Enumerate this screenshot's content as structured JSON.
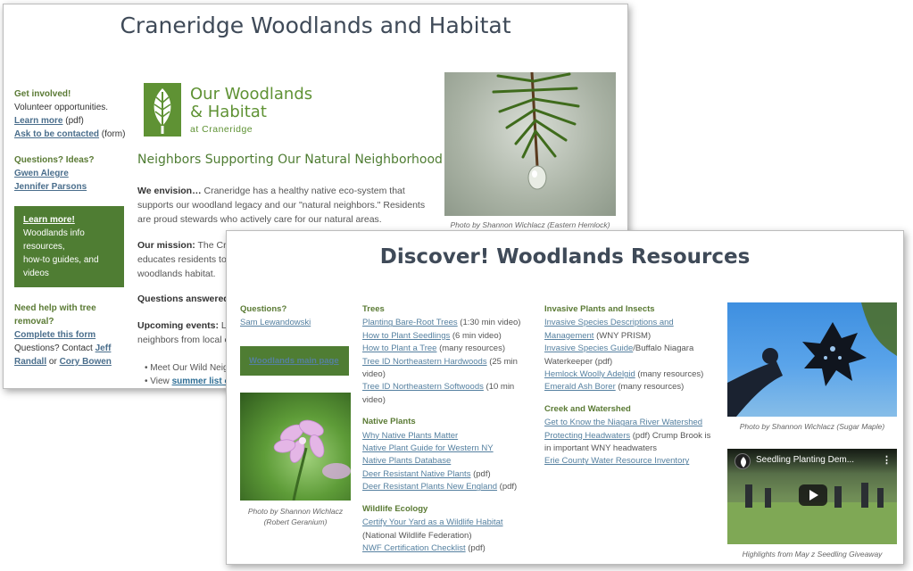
{
  "back": {
    "title": "Craneridge Woodlands and Habitat",
    "sidebar": {
      "involved_heading": "Get involved!",
      "volunteer_text": "Volunteer opportunities.",
      "learn_more": "Learn more",
      "learn_more_suffix": " (pdf)",
      "ask_contact": "Ask to be contacted",
      "ask_contact_suffix": " (form)",
      "questions_heading": "Questions? Ideas?",
      "contact1": "Gwen Alegre",
      "contact2": "Jennifer Parsons",
      "greenbox_title": "Learn more!",
      "greenbox_line1": "Woodlands info",
      "greenbox_line2": "resources,",
      "greenbox_line3": "how-to guides, and",
      "greenbox_line4": "videos",
      "tree_heading1": "Need help with tree",
      "tree_heading2": "removal?",
      "complete_form": "Complete this form",
      "questions_contact": "Questions? Contact ",
      "contact3a": "Jeff",
      "contact3b": "Randall",
      "or": " or ",
      "contact4": "Cory Bowen"
    },
    "logo": {
      "line1": "Our Woodlands",
      "line2": "& Habitat",
      "line3": "at Craneridge"
    },
    "headline": "Neighbors Supporting Our Natural Neighborhood",
    "envision_label": "We envision…",
    "envision_text": " Craneridge has a healthy native eco-system that supports our woodland legacy and our \"natural neighbors.\" Residents are proud stewards who actively care for our natural areas.",
    "mission_label": "Our mission:",
    "mission_text1": " The Cran",
    "mission_text2": "educates residents to",
    "mission_text3": "woodlands habitat.",
    "questions_answered": "Questions answered:",
    "upcoming_label": "Upcoming events:",
    "upcoming_text1": " Lot",
    "upcoming_text2": "neighbors from local e",
    "bullet1": "Meet Our Wild Neig",
    "bullet2_prefix": "View ",
    "bullet2_link": "summer list o",
    "photo_caption": "Photo by Shannon Wichlacz (Eastern Hemlock)"
  },
  "front": {
    "title": "Discover! Woodlands Resources",
    "col1": {
      "questions_heading": "Questions?",
      "contact": "Sam Lewandowski",
      "main_page_button": "Woodlands main page",
      "photo_caption1": "Photo by Shannon Wichlacz",
      "photo_caption2": "(Robert Geranium)"
    },
    "trees": {
      "heading": "Trees",
      "items": [
        {
          "link": "Planting Bare-Root Trees",
          "note": " (1:30 min video)"
        },
        {
          "link": "How to Plant Seedlings",
          "note": " (6 min video)"
        },
        {
          "link": "How to Plant a Tree",
          "note": " (many resources)"
        },
        {
          "link": "Tree ID Northeastern Hardwoods",
          "note": " (25 min video)"
        },
        {
          "link": "Tree ID Northeastern Softwoods",
          "note": " (10 min video)"
        }
      ]
    },
    "native_plants": {
      "heading": "Native Plants",
      "items": [
        {
          "link": "Why Native Plants Matter",
          "note": ""
        },
        {
          "link": "Native Plant Guide for Western NY",
          "note": ""
        },
        {
          "link": "Native Plants Database",
          "note": ""
        },
        {
          "link": "Deer Resistant Native Plants",
          "note": " (pdf)"
        },
        {
          "link": "Deer Resistant Plants New England",
          "note": " (pdf)"
        }
      ]
    },
    "wildlife": {
      "heading": "Wildlife Ecology",
      "items": [
        {
          "link": "Certify Your Yard as a Wildlife Habitat",
          "note": " (National Wildlife Federation)"
        },
        {
          "link": "NWF Certification Checklist",
          "note": " (pdf)"
        }
      ]
    },
    "invasive": {
      "heading": "Invasive Plants and Insects",
      "items": [
        {
          "link": "Invasive Species Descriptions and Management",
          "note": " (WNY PRISM)"
        },
        {
          "link": "Invasive Species Guide",
          "note": "/Buffalo Niagara Waterkeeper (pdf)"
        },
        {
          "link": "Hemlock Woolly Adelgid",
          "note": " (many resources)"
        },
        {
          "link": "Emerald Ash Borer",
          "note": " (many resources)"
        }
      ]
    },
    "creek": {
      "heading": "Creek and Watershed",
      "items": [
        {
          "link": "Get to Know the Niagara River Watershed",
          "note": ""
        },
        {
          "link": "Protecting Headwaters",
          "note": " (pdf) Crump Brook is in important WNY headwaters"
        },
        {
          "link": "Erie County Water Resource Inventory",
          "note": ""
        }
      ]
    },
    "maple_caption": "Photo by Shannon Wichlacz (Sugar Maple)",
    "video_title": "Seedling Planting Dem...",
    "video_caption": "Highlights from May z Seedling Giveaway"
  }
}
